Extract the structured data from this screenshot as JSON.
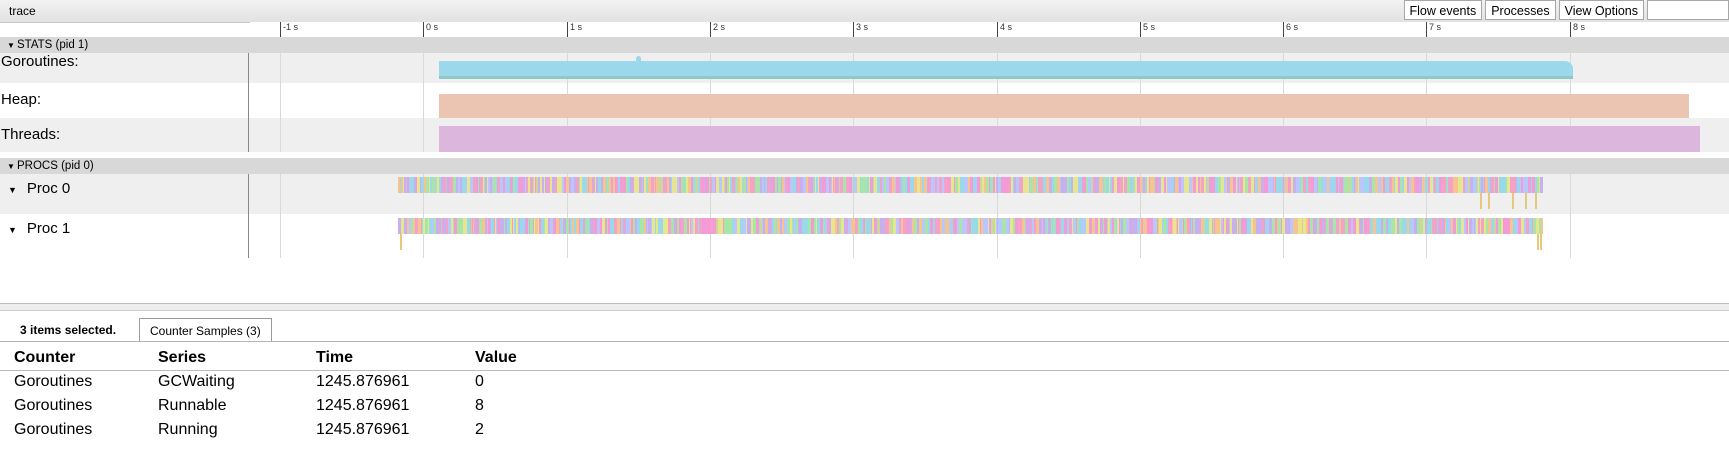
{
  "app": {
    "title": "trace"
  },
  "toolbar": {
    "flow_events": "Flow events",
    "processes": "Processes",
    "view_options": "View Options"
  },
  "ruler": {
    "labels": [
      "-1 s",
      "0 s",
      "1 s",
      "2 s",
      "3 s",
      "4 s",
      "5 s",
      "6 s",
      "7 s",
      "8 s"
    ]
  },
  "groups": {
    "stats": {
      "label": "STATS (pid 1)"
    },
    "procs": {
      "label": "PROCS (pid 0)"
    }
  },
  "tracks": {
    "goroutines": "Goroutines:",
    "heap": "Heap:",
    "threads": "Threads:",
    "proc0": "Proc 0",
    "proc1": "Proc 1"
  },
  "colors": {
    "goroutines": "#9bd8ec",
    "goroutines_base": "#8fc8c8",
    "heap": "#ecc4b2",
    "threads": "#ddb6dd",
    "proc_palette": [
      "#f49ad6",
      "#9ad8ec",
      "#a8e6a8",
      "#c8b0f0",
      "#f6c48e",
      "#f4a3c8",
      "#b8c8ff",
      "#e6e68e"
    ]
  },
  "selection": {
    "summary": "3 items selected.",
    "tab_label": "Counter Samples (3)"
  },
  "table": {
    "headers": [
      "Counter",
      "Series",
      "Time",
      "Value"
    ],
    "rows": [
      [
        "Goroutines",
        "GCWaiting",
        "1245.876961",
        "0"
      ],
      [
        "Goroutines",
        "Runnable",
        "1245.876961",
        "8"
      ],
      [
        "Goroutines",
        "Running",
        "1245.876961",
        "2"
      ]
    ]
  }
}
